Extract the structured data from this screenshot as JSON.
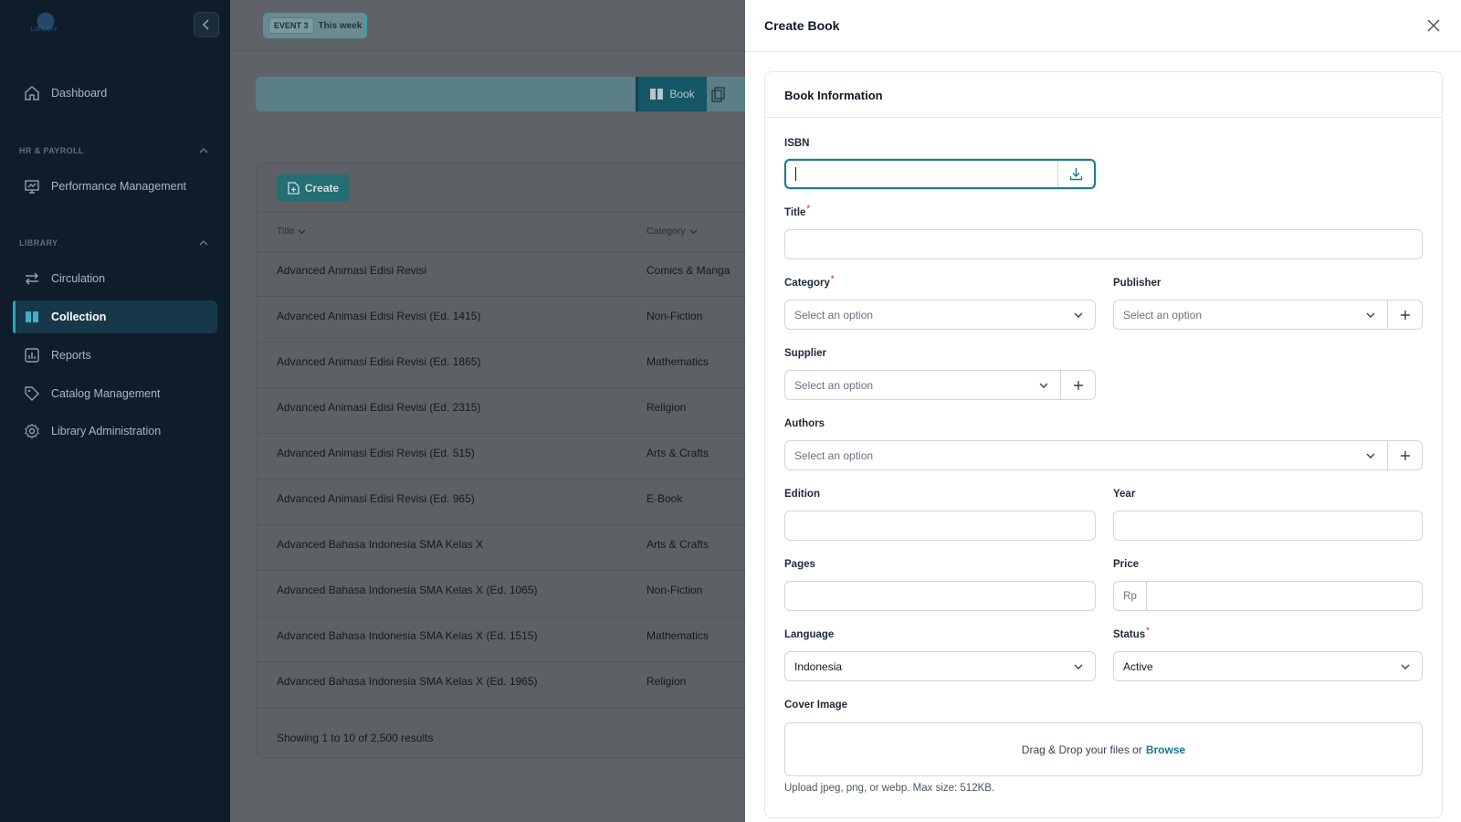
{
  "sidebar": {
    "logo_text": "LIBRARY",
    "items": [
      {
        "label": "Dashboard"
      },
      {
        "label": "Performance Management"
      },
      {
        "label": "Circulation"
      },
      {
        "label": "Collection"
      },
      {
        "label": "Reports"
      },
      {
        "label": "Catalog Management"
      },
      {
        "label": "Library Administration"
      }
    ],
    "sections": [
      {
        "label": "HR & PAYROLL"
      },
      {
        "label": "LIBRARY"
      }
    ]
  },
  "header": {
    "event_tag": "EVENT 3",
    "event_period": "This week"
  },
  "tabs": {
    "book": "Book"
  },
  "collection": {
    "create_label": "Create",
    "columns": [
      "Title",
      "Category"
    ],
    "rows": [
      {
        "title": "Advanced Animasi Edisi Revisi",
        "category": "Comics & Manga"
      },
      {
        "title": "Advanced Animasi Edisi Revisi (Ed. 1415)",
        "category": "Non-Fiction"
      },
      {
        "title": "Advanced Animasi Edisi Revisi (Ed. 1865)",
        "category": "Mathematics"
      },
      {
        "title": "Advanced Animasi Edisi Revisi (Ed. 2315)",
        "category": "Religion"
      },
      {
        "title": "Advanced Animasi Edisi Revisi (Ed. 515)",
        "category": "Arts & Crafts"
      },
      {
        "title": "Advanced Animasi Edisi Revisi (Ed. 965)",
        "category": "E-Book"
      },
      {
        "title": "Advanced Bahasa Indonesia SMA Kelas X",
        "category": "Arts & Crafts"
      },
      {
        "title": "Advanced Bahasa Indonesia SMA Kelas X (Ed. 1065)",
        "category": "Non-Fiction"
      },
      {
        "title": "Advanced Bahasa Indonesia SMA Kelas X (Ed. 1515)",
        "category": "Mathematics"
      },
      {
        "title": "Advanced Bahasa Indonesia SMA Kelas X (Ed. 1965)",
        "category": "Religion"
      }
    ],
    "footer": "Showing 1 to 10 of 2,500 results"
  },
  "drawer": {
    "title": "Create Book",
    "section_title": "Book Information",
    "required_mark": "*",
    "fields": {
      "isbn": {
        "label": "ISBN",
        "value": ""
      },
      "title": {
        "label": "Title",
        "value": ""
      },
      "category": {
        "label": "Category",
        "placeholder": "Select an option"
      },
      "publisher": {
        "label": "Publisher",
        "placeholder": "Select an option"
      },
      "supplier": {
        "label": "Supplier",
        "placeholder": "Select an option"
      },
      "authors": {
        "label": "Authors",
        "placeholder": "Select an option"
      },
      "edition": {
        "label": "Edition",
        "value": ""
      },
      "year": {
        "label": "Year",
        "value": ""
      },
      "pages": {
        "label": "Pages",
        "value": ""
      },
      "price": {
        "label": "Price",
        "prefix": "Rp",
        "value": ""
      },
      "language": {
        "label": "Language",
        "value": "Indonesia"
      },
      "status": {
        "label": "Status",
        "value": "Active"
      },
      "cover": {
        "label": "Cover Image",
        "drop_text": "Drag & Drop your files or",
        "browse_text": "Browse",
        "hint": "Upload jpeg, png, or webp. Max size: 512KB."
      }
    }
  },
  "colors": {
    "accent": "#1f7a8c",
    "sidebar_bg": "#0f1d2b",
    "required": "#ef4444"
  }
}
